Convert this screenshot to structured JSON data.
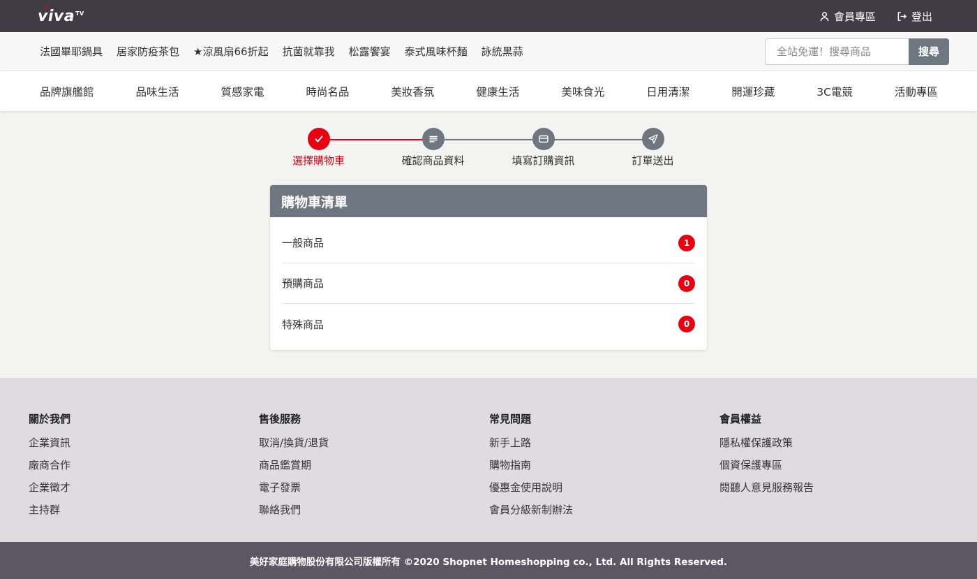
{
  "header": {
    "logo": "viva",
    "logo_tv": "TV",
    "logo_check": "✓",
    "member_link": "會員專區",
    "logout_link": "登出"
  },
  "promo": {
    "links": [
      "法國畢耶鍋具",
      "居家防疫茶包",
      "★涼風扇66折起",
      "抗菌就靠我",
      "松露饗宴",
      "泰式風味杯麵",
      "詠統黑蒜"
    ],
    "search_placeholder": "全站免運！搜尋商品",
    "search_button": "搜尋"
  },
  "categories": [
    "品牌旗艦館",
    "品味生活",
    "質感家電",
    "時尚名品",
    "美妝香氛",
    "健康生活",
    "美味食光",
    "日用清潔",
    "開運珍藏",
    "3C電競",
    "活動專區"
  ],
  "stepper": {
    "steps": [
      {
        "label": "選擇購物車",
        "icon": "check-icon",
        "active": true
      },
      {
        "label": "確認商品資料",
        "icon": "list-icon",
        "active": false
      },
      {
        "label": "填寫訂購資訊",
        "icon": "credit-card-icon",
        "active": false
      },
      {
        "label": "訂單送出",
        "icon": "send-icon",
        "active": false
      }
    ]
  },
  "cart": {
    "title": "購物車清單",
    "rows": [
      {
        "label": "一般商品",
        "count": "1"
      },
      {
        "label": "預購商品",
        "count": "0"
      },
      {
        "label": "特殊商品",
        "count": "0"
      }
    ]
  },
  "footer": {
    "columns": [
      {
        "title": "關於我們",
        "links": [
          "企業資訊",
          "廠商合作",
          "企業徵才",
          "主持群"
        ]
      },
      {
        "title": "售後服務",
        "links": [
          "取消/換貨/退貨",
          "商品鑑賞期",
          "電子發票",
          "聯絡我們"
        ]
      },
      {
        "title": "常見問題",
        "links": [
          "新手上路",
          "購物指南",
          "優惠金使用說明",
          "會員分級新制辦法"
        ]
      },
      {
        "title": "會員權益",
        "links": [
          "隱私權保護政策",
          "個資保護專區",
          "閱聽人意見服務報告"
        ]
      }
    ],
    "copyright": "美好家庭購物股份有限公司版權所有 ©2020 Shopnet Homeshopping co., Ltd. All Rights Reserved."
  },
  "colors": {
    "accent": "#e60012",
    "topbar": "#3f3c43",
    "gray": "#6e7680",
    "footer_bg": "#dedce1",
    "copyright_bg": "#5d5663"
  }
}
